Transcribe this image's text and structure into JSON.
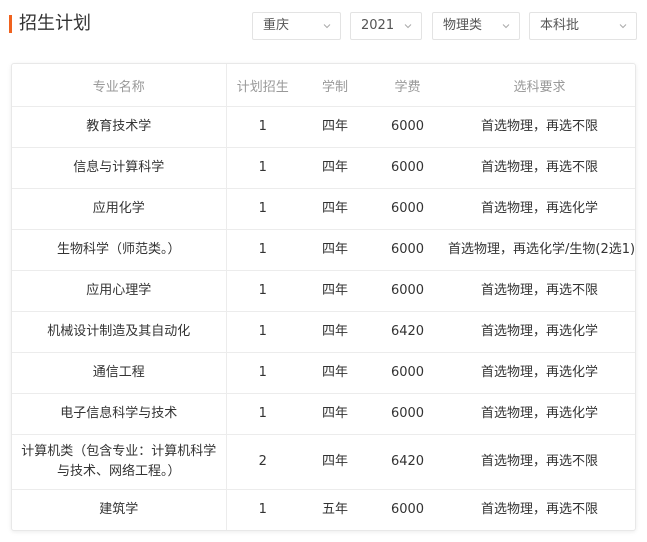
{
  "colors": {
    "accent": "#f0621e",
    "border": "#ececec",
    "header_text": "#999999"
  },
  "page_title": "招生计划",
  "filters": [
    {
      "name": "province-select",
      "value": "重庆",
      "icon": "chevron-down-icon"
    },
    {
      "name": "year-select",
      "value": "2021",
      "icon": "chevron-down-icon"
    },
    {
      "name": "subject-select",
      "value": "物理类",
      "icon": "chevron-down-icon"
    },
    {
      "name": "batch-select",
      "value": "本科批",
      "icon": "chevron-down-icon"
    }
  ],
  "table": {
    "headers": [
      "专业名称",
      "计划招生",
      "学制",
      "学费",
      "选科要求"
    ],
    "rows": [
      {
        "major": "教育技术学",
        "plan": "1",
        "years": "四年",
        "fee": "6000",
        "requirement": "首选物理，再选不限"
      },
      {
        "major": "信息与计算科学",
        "plan": "1",
        "years": "四年",
        "fee": "6000",
        "requirement": "首选物理，再选不限"
      },
      {
        "major": "应用化学",
        "plan": "1",
        "years": "四年",
        "fee": "6000",
        "requirement": "首选物理，再选化学"
      },
      {
        "major": "生物科学（师范类。）",
        "plan": "1",
        "years": "四年",
        "fee": "6000",
        "requirement": "首选物理，再选化学/生物(2选1)"
      },
      {
        "major": "应用心理学",
        "plan": "1",
        "years": "四年",
        "fee": "6000",
        "requirement": "首选物理，再选不限"
      },
      {
        "major": "机械设计制造及其自动化",
        "plan": "1",
        "years": "四年",
        "fee": "6420",
        "requirement": "首选物理，再选化学"
      },
      {
        "major": "通信工程",
        "plan": "1",
        "years": "四年",
        "fee": "6000",
        "requirement": "首选物理，再选化学"
      },
      {
        "major": "电子信息科学与技术",
        "plan": "1",
        "years": "四年",
        "fee": "6000",
        "requirement": "首选物理，再选化学"
      },
      {
        "major": "计算机类（包含专业：计算机科学与技术、网络工程。）",
        "plan": "2",
        "years": "四年",
        "fee": "6420",
        "requirement": "首选物理，再选不限"
      },
      {
        "major": "建筑学",
        "plan": "1",
        "years": "五年",
        "fee": "6000",
        "requirement": "首选物理，再选不限"
      }
    ]
  }
}
